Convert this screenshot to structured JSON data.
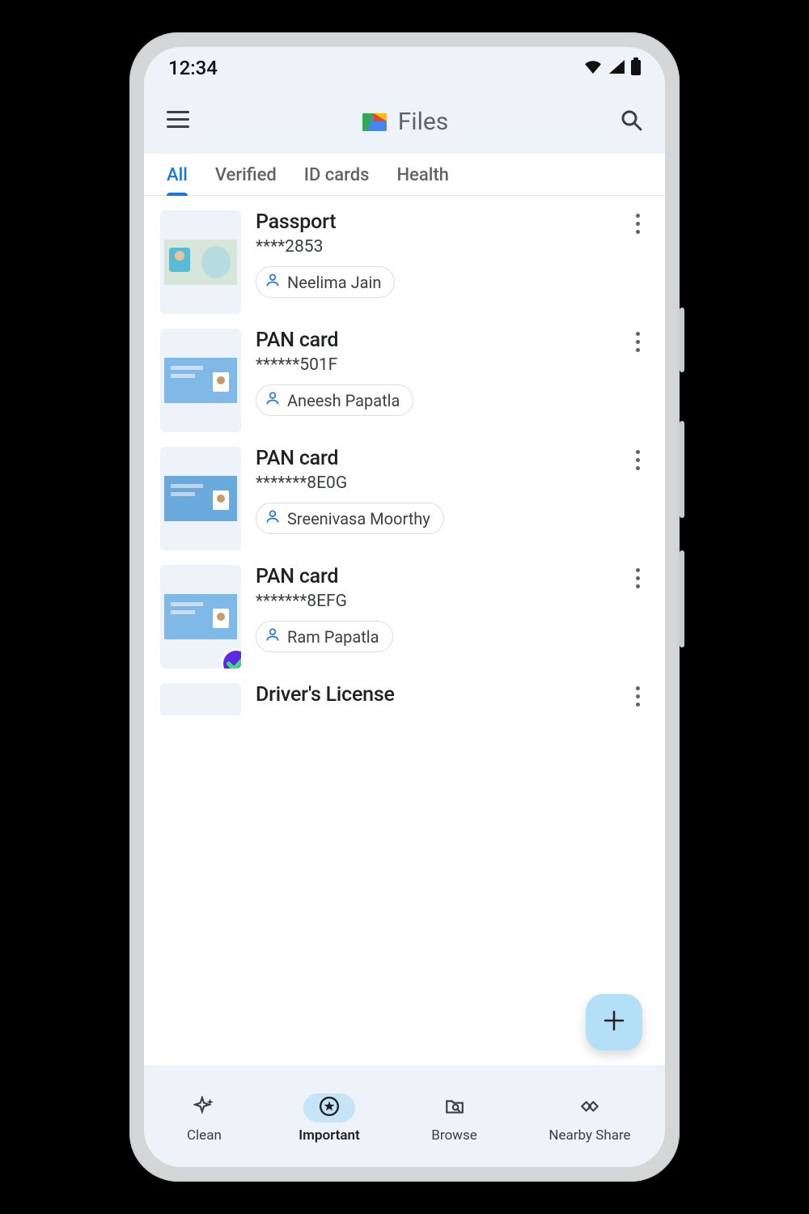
{
  "status": {
    "time": "12:34"
  },
  "appbar": {
    "title": "Files"
  },
  "tabs": [
    {
      "label": "All",
      "active": true
    },
    {
      "label": "Verified",
      "active": false
    },
    {
      "label": "ID cards",
      "active": false
    },
    {
      "label": "Health",
      "active": false
    }
  ],
  "docs": [
    {
      "title": "Passport",
      "number": "****2853",
      "owner": "Neelima Jain",
      "verified": false,
      "thumb": "passport"
    },
    {
      "title": "PAN card",
      "number": "******501F",
      "owner": "Aneesh Papatla",
      "verified": false,
      "thumb": "pan_blue"
    },
    {
      "title": "PAN card",
      "number": "*******8E0G",
      "owner": "Sreenivasa Moorthy",
      "verified": false,
      "thumb": "pan_blue"
    },
    {
      "title": "PAN card",
      "number": "*******8EFG",
      "owner": "Ram Papatla",
      "verified": true,
      "thumb": "pan_blue"
    },
    {
      "title": "Driver's License",
      "number": "",
      "owner": "",
      "verified": false,
      "thumb": "blank"
    }
  ],
  "nav": [
    {
      "label": "Clean",
      "icon": "sparkle",
      "active": false
    },
    {
      "label": "Important",
      "icon": "star",
      "active": true
    },
    {
      "label": "Browse",
      "icon": "folder",
      "active": false
    },
    {
      "label": "Nearby Share",
      "icon": "share",
      "active": false
    }
  ]
}
